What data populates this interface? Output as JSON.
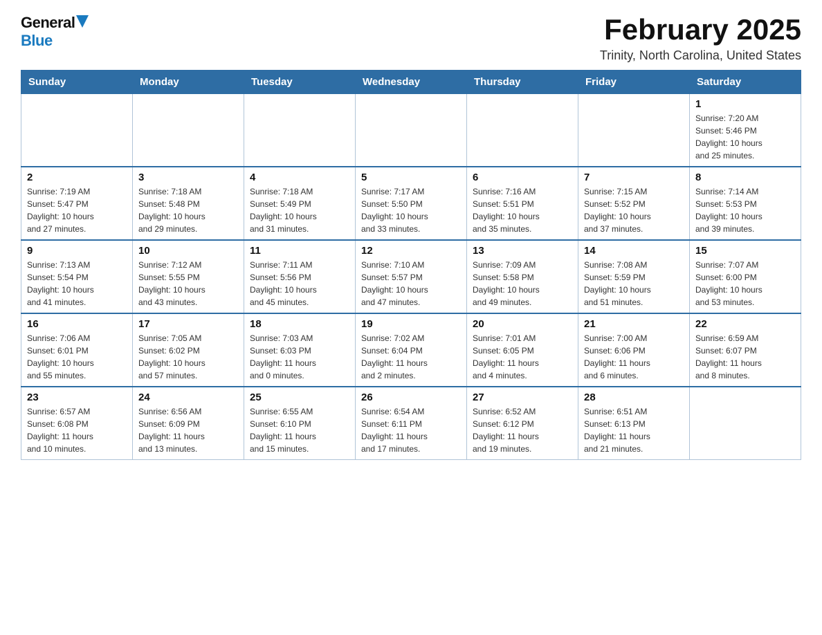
{
  "header": {
    "logo_general": "General",
    "logo_blue": "Blue",
    "month_title": "February 2025",
    "location": "Trinity, North Carolina, United States"
  },
  "days_of_week": [
    "Sunday",
    "Monday",
    "Tuesday",
    "Wednesday",
    "Thursday",
    "Friday",
    "Saturday"
  ],
  "weeks": [
    [
      {
        "day": "",
        "info": ""
      },
      {
        "day": "",
        "info": ""
      },
      {
        "day": "",
        "info": ""
      },
      {
        "day": "",
        "info": ""
      },
      {
        "day": "",
        "info": ""
      },
      {
        "day": "",
        "info": ""
      },
      {
        "day": "1",
        "info": "Sunrise: 7:20 AM\nSunset: 5:46 PM\nDaylight: 10 hours\nand 25 minutes."
      }
    ],
    [
      {
        "day": "2",
        "info": "Sunrise: 7:19 AM\nSunset: 5:47 PM\nDaylight: 10 hours\nand 27 minutes."
      },
      {
        "day": "3",
        "info": "Sunrise: 7:18 AM\nSunset: 5:48 PM\nDaylight: 10 hours\nand 29 minutes."
      },
      {
        "day": "4",
        "info": "Sunrise: 7:18 AM\nSunset: 5:49 PM\nDaylight: 10 hours\nand 31 minutes."
      },
      {
        "day": "5",
        "info": "Sunrise: 7:17 AM\nSunset: 5:50 PM\nDaylight: 10 hours\nand 33 minutes."
      },
      {
        "day": "6",
        "info": "Sunrise: 7:16 AM\nSunset: 5:51 PM\nDaylight: 10 hours\nand 35 minutes."
      },
      {
        "day": "7",
        "info": "Sunrise: 7:15 AM\nSunset: 5:52 PM\nDaylight: 10 hours\nand 37 minutes."
      },
      {
        "day": "8",
        "info": "Sunrise: 7:14 AM\nSunset: 5:53 PM\nDaylight: 10 hours\nand 39 minutes."
      }
    ],
    [
      {
        "day": "9",
        "info": "Sunrise: 7:13 AM\nSunset: 5:54 PM\nDaylight: 10 hours\nand 41 minutes."
      },
      {
        "day": "10",
        "info": "Sunrise: 7:12 AM\nSunset: 5:55 PM\nDaylight: 10 hours\nand 43 minutes."
      },
      {
        "day": "11",
        "info": "Sunrise: 7:11 AM\nSunset: 5:56 PM\nDaylight: 10 hours\nand 45 minutes."
      },
      {
        "day": "12",
        "info": "Sunrise: 7:10 AM\nSunset: 5:57 PM\nDaylight: 10 hours\nand 47 minutes."
      },
      {
        "day": "13",
        "info": "Sunrise: 7:09 AM\nSunset: 5:58 PM\nDaylight: 10 hours\nand 49 minutes."
      },
      {
        "day": "14",
        "info": "Sunrise: 7:08 AM\nSunset: 5:59 PM\nDaylight: 10 hours\nand 51 minutes."
      },
      {
        "day": "15",
        "info": "Sunrise: 7:07 AM\nSunset: 6:00 PM\nDaylight: 10 hours\nand 53 minutes."
      }
    ],
    [
      {
        "day": "16",
        "info": "Sunrise: 7:06 AM\nSunset: 6:01 PM\nDaylight: 10 hours\nand 55 minutes."
      },
      {
        "day": "17",
        "info": "Sunrise: 7:05 AM\nSunset: 6:02 PM\nDaylight: 10 hours\nand 57 minutes."
      },
      {
        "day": "18",
        "info": "Sunrise: 7:03 AM\nSunset: 6:03 PM\nDaylight: 11 hours\nand 0 minutes."
      },
      {
        "day": "19",
        "info": "Sunrise: 7:02 AM\nSunset: 6:04 PM\nDaylight: 11 hours\nand 2 minutes."
      },
      {
        "day": "20",
        "info": "Sunrise: 7:01 AM\nSunset: 6:05 PM\nDaylight: 11 hours\nand 4 minutes."
      },
      {
        "day": "21",
        "info": "Sunrise: 7:00 AM\nSunset: 6:06 PM\nDaylight: 11 hours\nand 6 minutes."
      },
      {
        "day": "22",
        "info": "Sunrise: 6:59 AM\nSunset: 6:07 PM\nDaylight: 11 hours\nand 8 minutes."
      }
    ],
    [
      {
        "day": "23",
        "info": "Sunrise: 6:57 AM\nSunset: 6:08 PM\nDaylight: 11 hours\nand 10 minutes."
      },
      {
        "day": "24",
        "info": "Sunrise: 6:56 AM\nSunset: 6:09 PM\nDaylight: 11 hours\nand 13 minutes."
      },
      {
        "day": "25",
        "info": "Sunrise: 6:55 AM\nSunset: 6:10 PM\nDaylight: 11 hours\nand 15 minutes."
      },
      {
        "day": "26",
        "info": "Sunrise: 6:54 AM\nSunset: 6:11 PM\nDaylight: 11 hours\nand 17 minutes."
      },
      {
        "day": "27",
        "info": "Sunrise: 6:52 AM\nSunset: 6:12 PM\nDaylight: 11 hours\nand 19 minutes."
      },
      {
        "day": "28",
        "info": "Sunrise: 6:51 AM\nSunset: 6:13 PM\nDaylight: 11 hours\nand 21 minutes."
      },
      {
        "day": "",
        "info": ""
      }
    ]
  ]
}
